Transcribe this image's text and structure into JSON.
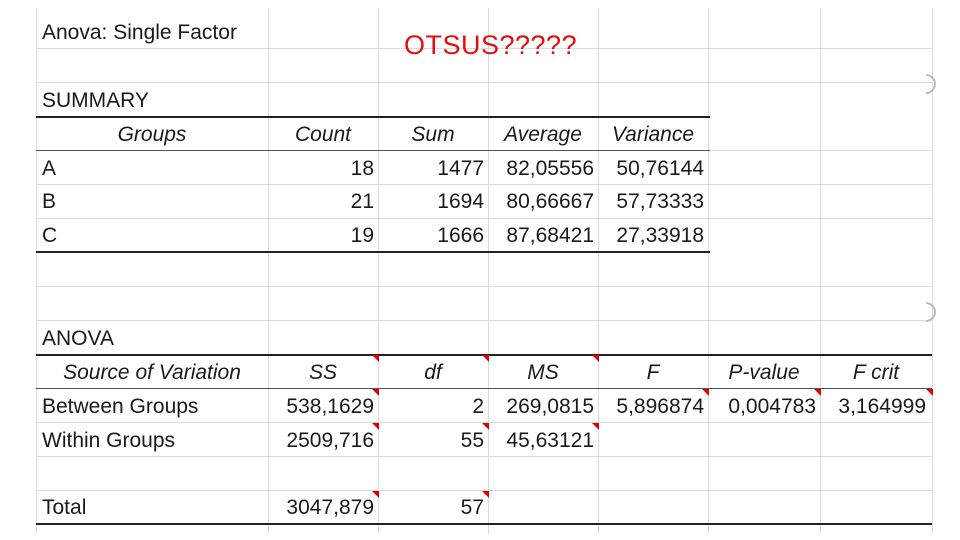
{
  "sheet": {
    "title": "Anova: Single Factor",
    "summary_label": "SUMMARY",
    "summary_headers": [
      "Groups",
      "Count",
      "Sum",
      "Average",
      "Variance"
    ],
    "summary_rows": [
      [
        "A",
        "18",
        "1477",
        "82,05556",
        "50,76144"
      ],
      [
        "B",
        "21",
        "1694",
        "80,66667",
        "57,73333"
      ],
      [
        "C",
        "19",
        "1666",
        "87,68421",
        "27,33918"
      ]
    ],
    "anova_label": "ANOVA",
    "anova_headers": [
      "Source of Variation",
      "SS",
      "df",
      "MS",
      "F",
      "P-value",
      "F crit"
    ],
    "anova_rows": [
      [
        "Between Groups",
        "538,1629",
        "2",
        "269,0815",
        "5,896874",
        "0,004783",
        "3,164999"
      ],
      [
        "Within Groups",
        "2509,716",
        "55",
        "45,63121",
        "",
        "",
        ""
      ]
    ],
    "total_row": [
      "Total",
      "3047,879",
      "57",
      "",
      "",
      "",
      ""
    ]
  },
  "overlay": {
    "text": "OTSUS?????",
    "color": "#e01010"
  },
  "colors": {
    "comment_marker": "#e00000",
    "gridline": "#dcdcdc",
    "rule": "#222222"
  }
}
